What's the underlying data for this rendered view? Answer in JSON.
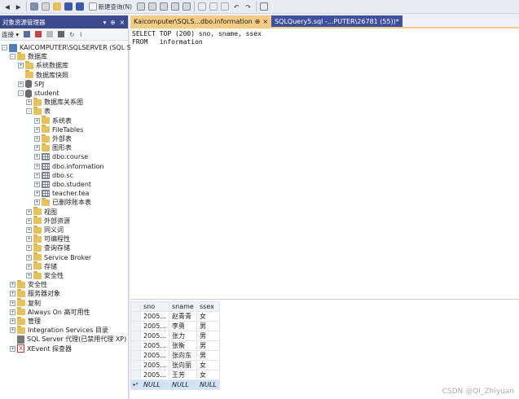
{
  "toolbar": {
    "new_query_label": "新建查询(N)"
  },
  "object_explorer": {
    "title": "对象资源管理器",
    "connect_label": "连接",
    "tree": [
      {
        "label": "KAICOMPUTER\\SQLSERVER (SQL Server",
        "icon": "server-icon",
        "level": 0,
        "expander": "-"
      },
      {
        "label": "数据库",
        "icon": "folder-icon",
        "level": 1,
        "expander": "-"
      },
      {
        "label": "系统数据库",
        "icon": "folder-icon",
        "level": 2,
        "expander": "+"
      },
      {
        "label": "数据库快照",
        "icon": "folder-icon",
        "level": 2,
        "expander": ""
      },
      {
        "label": "SPJ",
        "icon": "database-icon",
        "level": 2,
        "expander": "+"
      },
      {
        "label": "student",
        "icon": "database-icon",
        "level": 2,
        "expander": "-"
      },
      {
        "label": "数据库关系图",
        "icon": "folder-icon",
        "level": 3,
        "expander": "+"
      },
      {
        "label": "表",
        "icon": "folder-icon",
        "level": 3,
        "expander": "-"
      },
      {
        "label": "系统表",
        "icon": "folder-icon",
        "level": 4,
        "expander": "+"
      },
      {
        "label": "FileTables",
        "icon": "folder-icon",
        "level": 4,
        "expander": "+"
      },
      {
        "label": "外部表",
        "icon": "folder-icon",
        "level": 4,
        "expander": "+"
      },
      {
        "label": "图形表",
        "icon": "folder-icon",
        "level": 4,
        "expander": "+"
      },
      {
        "label": "dbo.course",
        "icon": "table-icon",
        "level": 4,
        "expander": "+"
      },
      {
        "label": "dbo.information",
        "icon": "table-icon",
        "level": 4,
        "expander": "+"
      },
      {
        "label": "dbo.sc",
        "icon": "table-icon",
        "level": 4,
        "expander": "+"
      },
      {
        "label": "dbo.student",
        "icon": "table-icon",
        "level": 4,
        "expander": "+"
      },
      {
        "label": "teacher.tea",
        "icon": "table-icon",
        "level": 4,
        "expander": "+"
      },
      {
        "label": "已删除账本表",
        "icon": "folder-icon",
        "level": 4,
        "expander": "+"
      },
      {
        "label": "视图",
        "icon": "folder-icon",
        "level": 3,
        "expander": "+"
      },
      {
        "label": "外部资源",
        "icon": "folder-icon",
        "level": 3,
        "expander": "+"
      },
      {
        "label": "同义词",
        "icon": "folder-icon",
        "level": 3,
        "expander": "+"
      },
      {
        "label": "可编程性",
        "icon": "folder-icon",
        "level": 3,
        "expander": "+"
      },
      {
        "label": "查询存储",
        "icon": "folder-icon",
        "level": 3,
        "expander": "+"
      },
      {
        "label": "Service Broker",
        "icon": "folder-icon",
        "level": 3,
        "expander": "+"
      },
      {
        "label": "存储",
        "icon": "folder-icon",
        "level": 3,
        "expander": "+"
      },
      {
        "label": "安全性",
        "icon": "folder-icon",
        "level": 3,
        "expander": "+"
      },
      {
        "label": "安全性",
        "icon": "folder-icon",
        "level": 1,
        "expander": "+"
      },
      {
        "label": "服务器对象",
        "icon": "folder-icon",
        "level": 1,
        "expander": "+"
      },
      {
        "label": "复制",
        "icon": "folder-icon",
        "level": 1,
        "expander": "+"
      },
      {
        "label": "Always On 高可用性",
        "icon": "folder-icon",
        "level": 1,
        "expander": "+"
      },
      {
        "label": "管理",
        "icon": "folder-icon",
        "level": 1,
        "expander": "+"
      },
      {
        "label": "Integration Services 目录",
        "icon": "folder-icon",
        "level": 1,
        "expander": "+"
      },
      {
        "label": "SQL Server 代理(已禁用代理 XP)",
        "icon": "agent-icon",
        "level": 1,
        "expander": ""
      },
      {
        "label": "XEvent 探查器",
        "icon": "xevent-icon",
        "level": 1,
        "expander": "+"
      }
    ]
  },
  "tabs": [
    {
      "label": "Kaicomputer\\SQLS...dbo.information",
      "pin": "⊕",
      "close": "×",
      "active": true
    },
    {
      "label": "SQLQuery5.sql -...PUTER\\26781 (55))*",
      "active": false
    }
  ],
  "editor": {
    "lines": [
      "SELECT TOP (200) sno, sname, ssex",
      "FROM   information"
    ]
  },
  "results": {
    "columns": [
      "sno",
      "sname",
      "ssex"
    ],
    "rows": [
      [
        "2005...",
        "赵青青",
        "女"
      ],
      [
        "2005...",
        "李勇",
        "男"
      ],
      [
        "2005...",
        "张力",
        "男"
      ],
      [
        "2005...",
        "张衡",
        "男"
      ],
      [
        "2005...",
        "张向东",
        "男"
      ],
      [
        "2005...",
        "张向丽",
        "女"
      ],
      [
        "2005...",
        "王芳",
        "女"
      ]
    ],
    "new_row": [
      "NULL",
      "NULL",
      "NULL"
    ]
  },
  "watermark": "CSDN @QI_Zhiyuan"
}
